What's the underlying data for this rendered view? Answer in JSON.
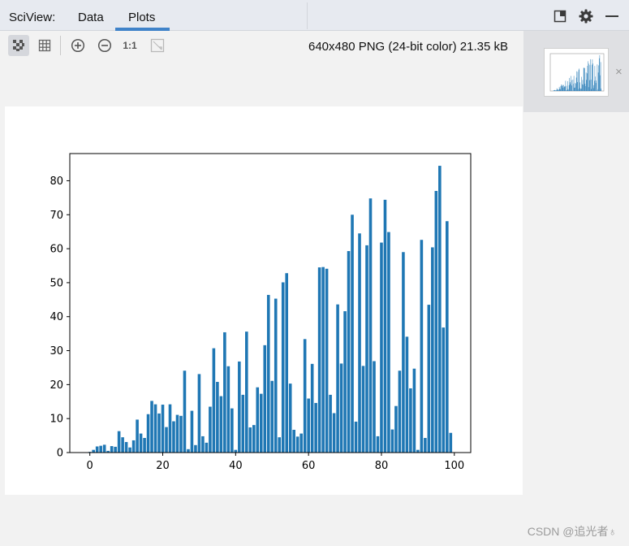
{
  "tabbar": {
    "app_label": "SciView:",
    "tabs": [
      {
        "label": "Data",
        "active": false
      },
      {
        "label": "Plots",
        "active": true
      }
    ]
  },
  "toolbar": {
    "image_info": "640x480 PNG (24-bit color) 21.35 kB",
    "zoom_actual_label": "1:1",
    "icons": [
      "transparency-checker-icon",
      "grid-icon",
      "zoom-in-icon",
      "zoom-out-icon",
      "actual-size-icon",
      "fit-to-window-icon"
    ]
  },
  "window_controls": [
    "restore-layout-icon",
    "gear-icon",
    "minimize-icon"
  ],
  "thumbnail": {
    "close_label": "×"
  },
  "watermark": "CSDN @追光者♁",
  "colors": {
    "bar": "#1f77b4",
    "accent": "#4083c9"
  },
  "chart_data": {
    "type": "bar",
    "title": "",
    "xlabel": "",
    "ylabel": "",
    "xlim": [
      -5.5,
      104.5
    ],
    "ylim": [
      0,
      88
    ],
    "xticks": [
      0,
      20,
      40,
      60,
      80,
      100
    ],
    "yticks": [
      0,
      10,
      20,
      30,
      40,
      50,
      60,
      70,
      80
    ],
    "x": [
      0,
      1,
      2,
      3,
      4,
      5,
      6,
      7,
      8,
      9,
      10,
      11,
      12,
      13,
      14,
      15,
      16,
      17,
      18,
      19,
      20,
      21,
      22,
      23,
      24,
      25,
      26,
      27,
      28,
      29,
      30,
      31,
      32,
      33,
      34,
      35,
      36,
      37,
      38,
      39,
      40,
      41,
      42,
      43,
      44,
      45,
      46,
      47,
      48,
      49,
      50,
      51,
      52,
      53,
      54,
      55,
      56,
      57,
      58,
      59,
      60,
      61,
      62,
      63,
      64,
      65,
      66,
      67,
      68,
      69,
      70,
      71,
      72,
      73,
      74,
      75,
      76,
      77,
      78,
      79,
      80,
      81,
      82,
      83,
      84,
      85,
      86,
      87,
      88,
      89,
      90,
      91,
      92,
      93,
      94,
      95,
      96,
      97,
      98,
      99
    ],
    "values": [
      0.2,
      0.8,
      1.8,
      2.0,
      2.3,
      0.5,
      1.9,
      1.7,
      6.3,
      4.5,
      3.1,
      1.5,
      3.6,
      9.7,
      5.6,
      4.3,
      11.3,
      15.2,
      14.2,
      11.5,
      14.1,
      7.5,
      14.2,
      9.2,
      11.1,
      10.8,
      24.1,
      1.0,
      12.3,
      2.2,
      23.1,
      4.8,
      2.9,
      13.5,
      30.7,
      20.8,
      16.6,
      35.4,
      25.4,
      13.0,
      0.8,
      26.8,
      17.0,
      35.6,
      7.4,
      8.1,
      19.2,
      17.3,
      31.6,
      46.4,
      21.1,
      45.3,
      4.5,
      50.1,
      52.8,
      20.3,
      6.7,
      4.7,
      5.6,
      33.4,
      15.9,
      26.1,
      14.6,
      54.5,
      54.6,
      54.1,
      17.0,
      11.6,
      43.6,
      26.2,
      41.6,
      59.3,
      70.0,
      9.1,
      64.5,
      25.5,
      61.0,
      74.8,
      26.9,
      4.8,
      61.8,
      74.4,
      64.9,
      6.8,
      13.7,
      24.1,
      59.0,
      34.1,
      18.9,
      24.7,
      0.8,
      62.6,
      4.3,
      43.5,
      60.4,
      77.0,
      84.4,
      36.8,
      68.1,
      5.8
    ]
  }
}
